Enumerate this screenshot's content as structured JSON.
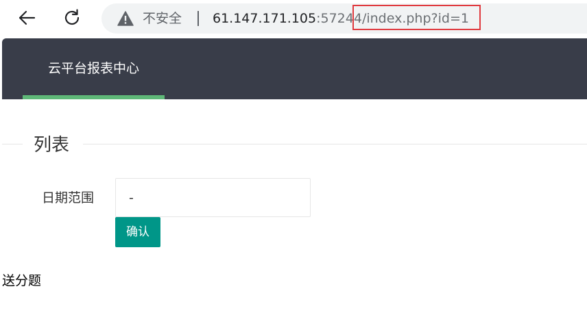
{
  "browser": {
    "security_label": "不安全",
    "url_host": "61.147.171.105",
    "url_port": ":57244",
    "url_path": "/index.php?id=1",
    "highlight_color": "#e0393e"
  },
  "header": {
    "title": "云平台报表中心",
    "background_color": "#393d49",
    "underline_color": "#5fb878"
  },
  "form": {
    "legend": "列表",
    "date_label": "日期范围",
    "date_value": "-",
    "confirm_label": "确认",
    "button_color": "#009688"
  },
  "footer": {
    "text": "送分题"
  }
}
